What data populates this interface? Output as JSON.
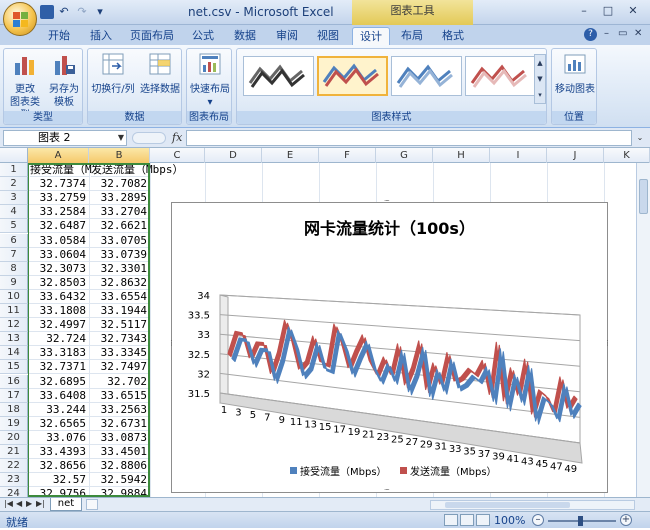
{
  "window": {
    "title": "net.csv - Microsoft Excel",
    "context_tab": "图表工具",
    "controls": [
      "–",
      "□",
      "✕"
    ]
  },
  "qat": [
    "save-icon",
    "undo-icon",
    "redo-icon",
    "customize-icon"
  ],
  "tabs": [
    "开始",
    "插入",
    "页面布局",
    "公式",
    "数据",
    "审阅",
    "视图",
    "设计",
    "布局",
    "格式"
  ],
  "active_tab": "设计",
  "ribbon": {
    "groups": {
      "type": {
        "label": "类型",
        "buttons": [
          {
            "label_line1": "更改",
            "label_line2": "图表类型"
          },
          {
            "label_line1": "另存为",
            "label_line2": "模板"
          }
        ]
      },
      "data": {
        "label": "数据",
        "buttons": [
          {
            "label_line1": "切换行/列"
          },
          {
            "label_line1": "选择数据"
          }
        ]
      },
      "layout": {
        "label": "图表布局",
        "buttons": [
          {
            "label_line1": "快速布局",
            "label_line2": "▾"
          }
        ]
      },
      "styles": {
        "label": "图表样式"
      },
      "location": {
        "label": "位置",
        "buttons": [
          {
            "label_line1": "移动图表"
          }
        ]
      }
    }
  },
  "formula_bar": {
    "name_box": "图表 2",
    "fx": "fx",
    "formula": ""
  },
  "sheet": {
    "columns": [
      "A",
      "B",
      "C",
      "D",
      "E",
      "F",
      "G",
      "H",
      "I",
      "J",
      "K"
    ],
    "selected_columns": [
      "A",
      "B"
    ],
    "header_row": {
      "a": "接受流量（M",
      "b": "发送流量（Mbps）"
    },
    "rows": [
      [
        "2",
        "32.7374",
        "32.7082"
      ],
      [
        "3",
        "33.2759",
        "33.2895"
      ],
      [
        "4",
        "33.2584",
        "33.2704"
      ],
      [
        "5",
        "32.6487",
        "32.6621"
      ],
      [
        "6",
        "33.0584",
        "33.0705"
      ],
      [
        "7",
        "33.0604",
        "33.0739"
      ],
      [
        "8",
        "32.3073",
        "32.3301"
      ],
      [
        "9",
        "32.8503",
        "32.8632"
      ],
      [
        "10",
        "33.6432",
        "33.6554"
      ],
      [
        "11",
        "33.1808",
        "33.1944"
      ],
      [
        "12",
        "32.4997",
        "32.5117"
      ],
      [
        "13",
        "32.724",
        "32.7343"
      ],
      [
        "14",
        "33.3183",
        "33.3345"
      ],
      [
        "15",
        "32.7371",
        "32.7497"
      ],
      [
        "16",
        "32.6895",
        "32.702"
      ],
      [
        "17",
        "33.6408",
        "33.6515"
      ],
      [
        "18",
        "33.244",
        "33.2563"
      ],
      [
        "19",
        "32.6565",
        "32.6731"
      ],
      [
        "20",
        "33.076",
        "33.0873"
      ],
      [
        "21",
        "33.4393",
        "33.4501"
      ],
      [
        "22",
        "32.8656",
        "32.8806"
      ],
      [
        "23",
        "32.57",
        "32.5942"
      ],
      [
        "24",
        "32.9756",
        "32.9884"
      ]
    ],
    "row1_label": "1"
  },
  "sheet_tab": "net",
  "status": {
    "ready": "就绪",
    "zoom": "100%"
  },
  "chart_data": {
    "type": "line",
    "title": "网卡流量统计（100s）",
    "x": [
      1,
      2,
      3,
      4,
      5,
      6,
      7,
      8,
      9,
      10,
      11,
      12,
      13,
      14,
      15,
      16,
      17,
      18,
      19,
      20,
      21,
      22,
      23,
      24,
      25,
      26,
      27,
      28,
      29,
      30,
      31,
      32,
      33,
      34,
      35,
      36,
      37,
      38,
      39,
      40,
      41,
      42,
      43,
      44,
      45,
      46,
      47,
      48,
      49,
      50
    ],
    "x_tick_labels": [
      "1",
      "3",
      "5",
      "7",
      "9",
      "11",
      "13",
      "15",
      "17",
      "19",
      "21",
      "23",
      "25",
      "27",
      "29",
      "31",
      "33",
      "35",
      "37",
      "39",
      "41",
      "43",
      "45",
      "47",
      "49"
    ],
    "ylim": [
      31.5,
      34
    ],
    "y_ticks": [
      "34",
      "33.5",
      "33",
      "32.5",
      "32",
      "31.5"
    ],
    "series": [
      {
        "name": "接受流量（Mbps）",
        "color": "#4f81bd",
        "values": [
          32.74,
          33.28,
          33.26,
          32.65,
          33.06,
          33.06,
          32.31,
          32.85,
          33.64,
          33.18,
          32.5,
          32.72,
          33.32,
          32.74,
          32.69,
          33.64,
          33.24,
          32.66,
          33.08,
          33.44,
          32.87,
          32.57,
          32.98,
          32.6,
          33.3,
          32.4,
          32.8,
          33.4,
          32.35,
          32.95,
          32.5,
          33.2,
          32.6,
          32.7,
          32.9,
          32.8,
          33.1,
          32.4,
          33.5,
          32.3,
          33.0,
          32.45,
          33.2,
          32.1,
          32.6,
          32.5,
          32.2,
          32.9,
          32.3,
          32.55
        ]
      },
      {
        "name": "发送流量（Mbps）",
        "color": "#c0504d",
        "values": [
          32.71,
          33.29,
          33.27,
          32.66,
          33.07,
          33.07,
          32.33,
          32.86,
          33.66,
          33.19,
          32.51,
          32.73,
          33.33,
          32.75,
          32.7,
          33.65,
          33.26,
          32.67,
          33.09,
          33.45,
          32.88,
          32.59,
          32.99,
          32.62,
          33.31,
          32.42,
          32.82,
          33.41,
          32.37,
          32.96,
          32.52,
          33.21,
          32.62,
          32.72,
          32.92,
          32.82,
          33.11,
          32.42,
          33.51,
          32.32,
          33.01,
          32.47,
          33.21,
          32.12,
          32.62,
          32.52,
          32.22,
          32.92,
          32.32,
          32.57
        ]
      }
    ],
    "legend_position": "bottom",
    "grid": true,
    "view": "3D"
  }
}
